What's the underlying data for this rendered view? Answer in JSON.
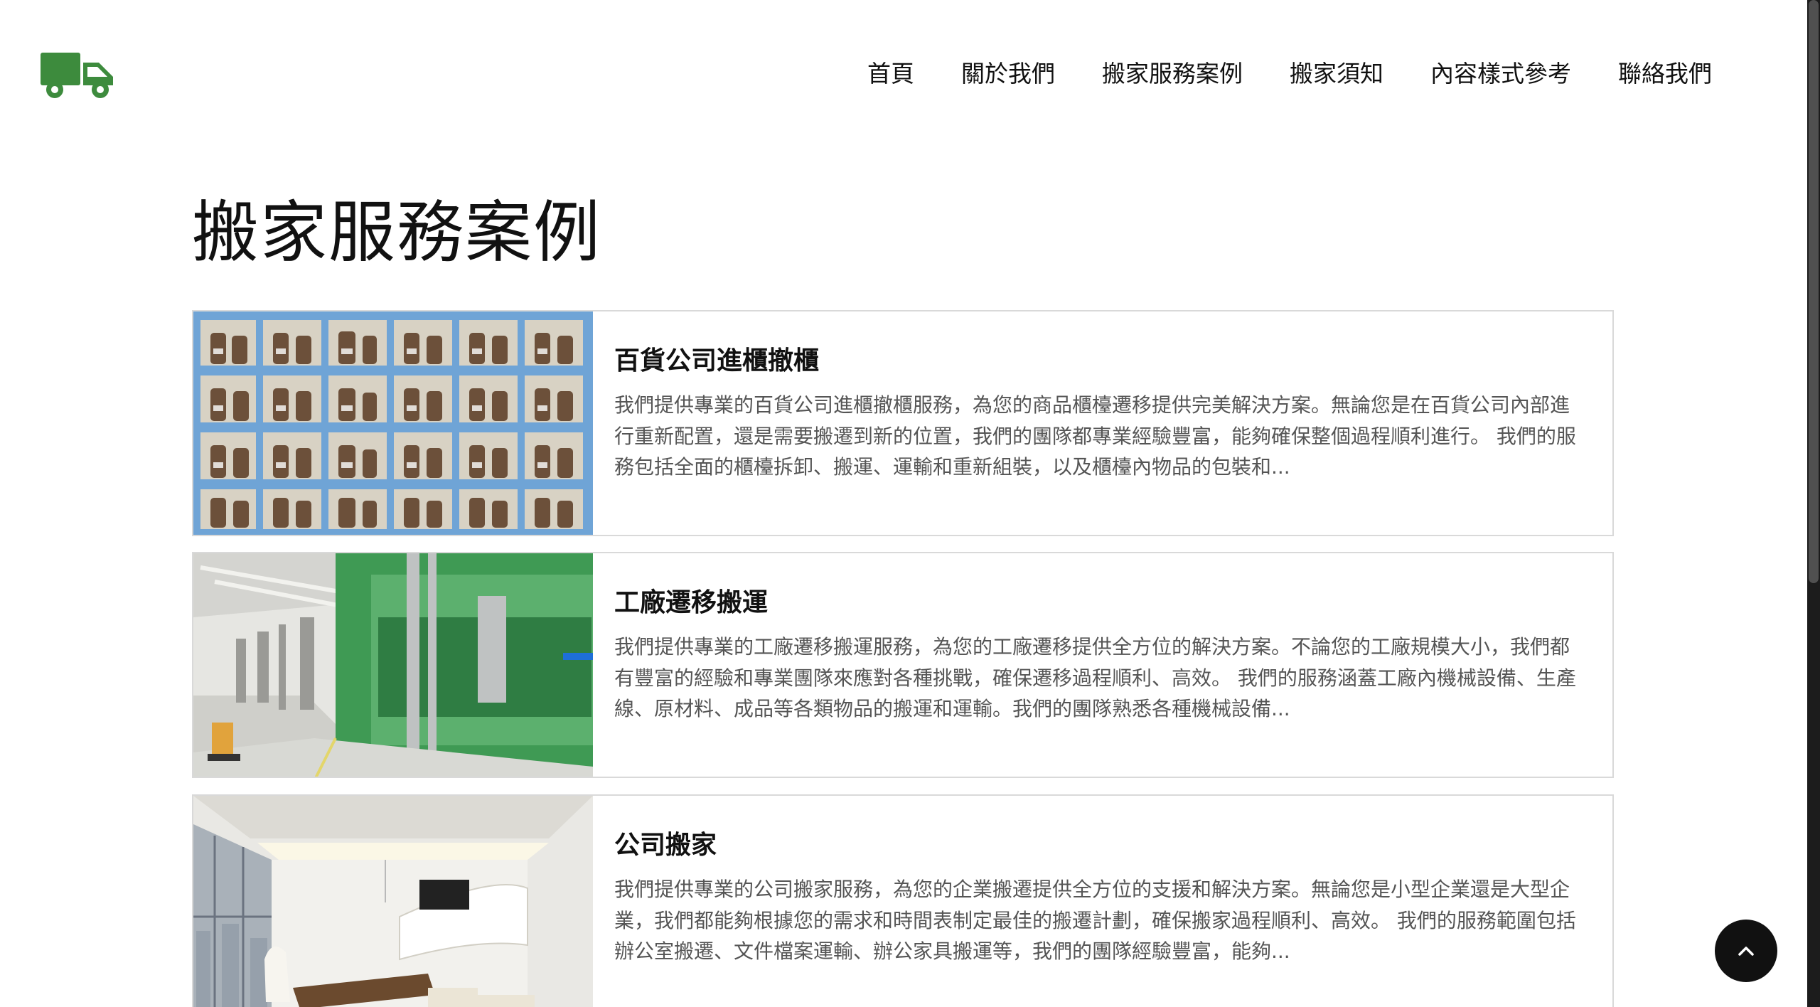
{
  "colors": {
    "brand_green": "#3d8b3d",
    "text_primary": "#111111",
    "text_secondary": "#555555",
    "card_border": "#d9d9d9",
    "back_to_top_bg": "#111111"
  },
  "header": {
    "logo_icon": "truck-icon",
    "nav": [
      {
        "label": "首頁"
      },
      {
        "label": "關於我們"
      },
      {
        "label": "搬家服務案例"
      },
      {
        "label": "搬家須知"
      },
      {
        "label": "內容樣式參考"
      },
      {
        "label": "聯絡我們"
      }
    ]
  },
  "main": {
    "title": "搬家服務案例",
    "cases": [
      {
        "title": "百貨公司進櫃撤櫃",
        "description": "我們提供專業的百貨公司進櫃撤櫃服務，為您的商品櫃檯遷移提供完美解決方案。無論您是在百貨公司內部進行重新配置，還是需要搬遷到新的位置，我們的團隊都專業經驗豐富，能夠確保整個過程順利進行。 我們的服務包括全面的櫃檯拆卸、搬運、運輸和重新組裝，以及櫃檯內物品的包裝和..."
      },
      {
        "title": "工廠遷移搬運",
        "description": "我們提供專業的工廠遷移搬運服務，為您的工廠遷移提供全方位的解決方案。不論您的工廠規模大小，我們都有豐富的經驗和專業團隊來應對各種挑戰，確保遷移過程順利、高效。 我們的服務涵蓋工廠內機械設備、生產線、原材料、成品等各類物品的搬運和運輸。我們的團隊熟悉各種機械設備..."
      },
      {
        "title": "公司搬家",
        "description": "我們提供專業的公司搬家服務，為您的企業搬遷提供全方位的支援和解決方案。無論您是小型企業還是大型企業，我們都能夠根據您的需求和時間表制定最佳的搬遷計劃，確保搬家過程順利、高效。 我們的服務範圍包括辦公室搬遷、文件檔案運輸、辦公家具搬運等，我們的團隊經驗豐富，能夠..."
      }
    ]
  },
  "back_to_top": {
    "icon": "chevron-up-icon"
  }
}
